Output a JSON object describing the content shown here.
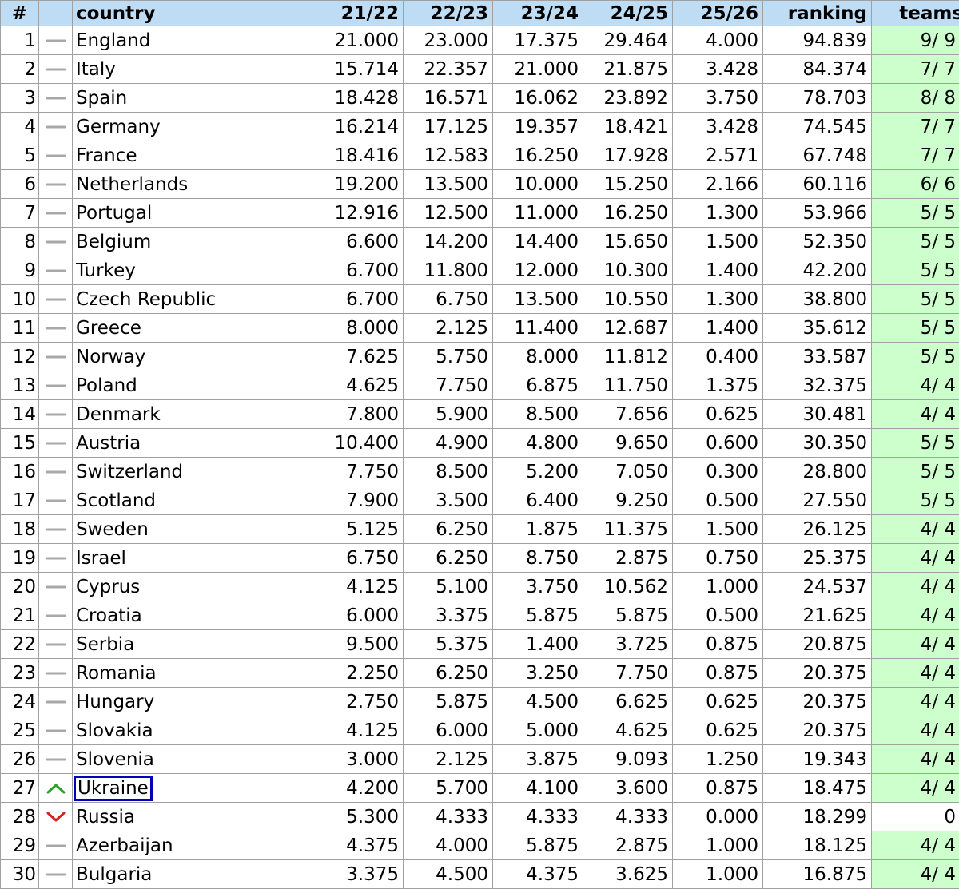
{
  "table": {
    "headers": {
      "pos": "#",
      "trend": "",
      "country": "country",
      "s1": "21/22",
      "s2": "22/23",
      "s3": "23/24",
      "s4": "24/25",
      "s5": "25/26",
      "ranking": "ranking",
      "teams": "teams"
    },
    "rows": [
      {
        "pos": "1",
        "trend": "same",
        "country": "England",
        "s1": "21.000",
        "s2": "23.000",
        "s3": "17.375",
        "s4": "29.464",
        "s5": "4.000",
        "ranking": "94.839",
        "teams": "9/ 9"
      },
      {
        "pos": "2",
        "trend": "same",
        "country": "Italy",
        "s1": "15.714",
        "s2": "22.357",
        "s3": "21.000",
        "s4": "21.875",
        "s5": "3.428",
        "ranking": "84.374",
        "teams": "7/ 7"
      },
      {
        "pos": "3",
        "trend": "same",
        "country": "Spain",
        "s1": "18.428",
        "s2": "16.571",
        "s3": "16.062",
        "s4": "23.892",
        "s5": "3.750",
        "ranking": "78.703",
        "teams": "8/ 8"
      },
      {
        "pos": "4",
        "trend": "same",
        "country": "Germany",
        "s1": "16.214",
        "s2": "17.125",
        "s3": "19.357",
        "s4": "18.421",
        "s5": "3.428",
        "ranking": "74.545",
        "teams": "7/ 7"
      },
      {
        "pos": "5",
        "trend": "same",
        "country": "France",
        "s1": "18.416",
        "s2": "12.583",
        "s3": "16.250",
        "s4": "17.928",
        "s5": "2.571",
        "ranking": "67.748",
        "teams": "7/ 7"
      },
      {
        "pos": "6",
        "trend": "same",
        "country": "Netherlands",
        "s1": "19.200",
        "s2": "13.500",
        "s3": "10.000",
        "s4": "15.250",
        "s5": "2.166",
        "ranking": "60.116",
        "teams": "6/ 6"
      },
      {
        "pos": "7",
        "trend": "same",
        "country": "Portugal",
        "s1": "12.916",
        "s2": "12.500",
        "s3": "11.000",
        "s4": "16.250",
        "s5": "1.300",
        "ranking": "53.966",
        "teams": "5/ 5"
      },
      {
        "pos": "8",
        "trend": "same",
        "country": "Belgium",
        "s1": "6.600",
        "s2": "14.200",
        "s3": "14.400",
        "s4": "15.650",
        "s5": "1.500",
        "ranking": "52.350",
        "teams": "5/ 5"
      },
      {
        "pos": "9",
        "trend": "same",
        "country": "Turkey",
        "s1": "6.700",
        "s2": "11.800",
        "s3": "12.000",
        "s4": "10.300",
        "s5": "1.400",
        "ranking": "42.200",
        "teams": "5/ 5"
      },
      {
        "pos": "10",
        "trend": "same",
        "country": "Czech Republic",
        "s1": "6.700",
        "s2": "6.750",
        "s3": "13.500",
        "s4": "10.550",
        "s5": "1.300",
        "ranking": "38.800",
        "teams": "5/ 5"
      },
      {
        "pos": "11",
        "trend": "same",
        "country": "Greece",
        "s1": "8.000",
        "s2": "2.125",
        "s3": "11.400",
        "s4": "12.687",
        "s5": "1.400",
        "ranking": "35.612",
        "teams": "5/ 5"
      },
      {
        "pos": "12",
        "trend": "same",
        "country": "Norway",
        "s1": "7.625",
        "s2": "5.750",
        "s3": "8.000",
        "s4": "11.812",
        "s5": "0.400",
        "ranking": "33.587",
        "teams": "5/ 5"
      },
      {
        "pos": "13",
        "trend": "same",
        "country": "Poland",
        "s1": "4.625",
        "s2": "7.750",
        "s3": "6.875",
        "s4": "11.750",
        "s5": "1.375",
        "ranking": "32.375",
        "teams": "4/ 4"
      },
      {
        "pos": "14",
        "trend": "same",
        "country": "Denmark",
        "s1": "7.800",
        "s2": "5.900",
        "s3": "8.500",
        "s4": "7.656",
        "s5": "0.625",
        "ranking": "30.481",
        "teams": "4/ 4"
      },
      {
        "pos": "15",
        "trend": "same",
        "country": "Austria",
        "s1": "10.400",
        "s2": "4.900",
        "s3": "4.800",
        "s4": "9.650",
        "s5": "0.600",
        "ranking": "30.350",
        "teams": "5/ 5"
      },
      {
        "pos": "16",
        "trend": "same",
        "country": "Switzerland",
        "s1": "7.750",
        "s2": "8.500",
        "s3": "5.200",
        "s4": "7.050",
        "s5": "0.300",
        "ranking": "28.800",
        "teams": "5/ 5"
      },
      {
        "pos": "17",
        "trend": "same",
        "country": "Scotland",
        "s1": "7.900",
        "s2": "3.500",
        "s3": "6.400",
        "s4": "9.250",
        "s5": "0.500",
        "ranking": "27.550",
        "teams": "5/ 5"
      },
      {
        "pos": "18",
        "trend": "same",
        "country": "Sweden",
        "s1": "5.125",
        "s2": "6.250",
        "s3": "1.875",
        "s4": "11.375",
        "s5": "1.500",
        "ranking": "26.125",
        "teams": "4/ 4"
      },
      {
        "pos": "19",
        "trend": "same",
        "country": "Israel",
        "s1": "6.750",
        "s2": "6.250",
        "s3": "8.750",
        "s4": "2.875",
        "s5": "0.750",
        "ranking": "25.375",
        "teams": "4/ 4"
      },
      {
        "pos": "20",
        "trend": "same",
        "country": "Cyprus",
        "s1": "4.125",
        "s2": "5.100",
        "s3": "3.750",
        "s4": "10.562",
        "s5": "1.000",
        "ranking": "24.537",
        "teams": "4/ 4"
      },
      {
        "pos": "21",
        "trend": "same",
        "country": "Croatia",
        "s1": "6.000",
        "s2": "3.375",
        "s3": "5.875",
        "s4": "5.875",
        "s5": "0.500",
        "ranking": "21.625",
        "teams": "4/ 4"
      },
      {
        "pos": "22",
        "trend": "same",
        "country": "Serbia",
        "s1": "9.500",
        "s2": "5.375",
        "s3": "1.400",
        "s4": "3.725",
        "s5": "0.875",
        "ranking": "20.875",
        "teams": "4/ 4"
      },
      {
        "pos": "23",
        "trend": "same",
        "country": "Romania",
        "s1": "2.250",
        "s2": "6.250",
        "s3": "3.250",
        "s4": "7.750",
        "s5": "0.875",
        "ranking": "20.375",
        "teams": "4/ 4"
      },
      {
        "pos": "24",
        "trend": "same",
        "country": "Hungary",
        "s1": "2.750",
        "s2": "5.875",
        "s3": "4.500",
        "s4": "6.625",
        "s5": "0.625",
        "ranking": "20.375",
        "teams": "4/ 4"
      },
      {
        "pos": "25",
        "trend": "same",
        "country": "Slovakia",
        "s1": "4.125",
        "s2": "6.000",
        "s3": "5.000",
        "s4": "4.625",
        "s5": "0.625",
        "ranking": "20.375",
        "teams": "4/ 4"
      },
      {
        "pos": "26",
        "trend": "same",
        "country": "Slovenia",
        "s1": "3.000",
        "s2": "2.125",
        "s3": "3.875",
        "s4": "9.093",
        "s5": "1.250",
        "ranking": "19.343",
        "teams": "4/ 4"
      },
      {
        "pos": "27",
        "trend": "up",
        "country": "Ukraine",
        "selected": true,
        "s1": "4.200",
        "s2": "5.700",
        "s3": "4.100",
        "s4": "3.600",
        "s5": "0.875",
        "ranking": "18.475",
        "teams": "4/ 4"
      },
      {
        "pos": "28",
        "trend": "down",
        "country": "Russia",
        "s1": "5.300",
        "s2": "4.333",
        "s3": "4.333",
        "s4": "4.333",
        "s5": "0.000",
        "ranking": "18.299",
        "teams": "0"
      },
      {
        "pos": "29",
        "trend": "same",
        "country": "Azerbaijan",
        "s1": "4.375",
        "s2": "4.000",
        "s3": "5.875",
        "s4": "2.875",
        "s5": "1.000",
        "ranking": "18.125",
        "teams": "4/ 4"
      },
      {
        "pos": "30",
        "trend": "same",
        "country": "Bulgaria",
        "s1": "3.375",
        "s2": "4.500",
        "s3": "4.375",
        "s4": "3.625",
        "s5": "1.000",
        "ranking": "16.875",
        "teams": "4/ 4"
      }
    ]
  },
  "colors": {
    "header_bg": "#bfdcf5",
    "teams_bg": "#ccffcc",
    "grid_line": "#a0a0a0",
    "selection_outline": "#0000bb",
    "trend_up": "#2e9e2e",
    "trend_down": "#d42020",
    "trend_same": "#a8a8a8"
  },
  "icons": {
    "same": "dash-icon",
    "up": "arrow-up-icon",
    "down": "arrow-down-icon"
  }
}
